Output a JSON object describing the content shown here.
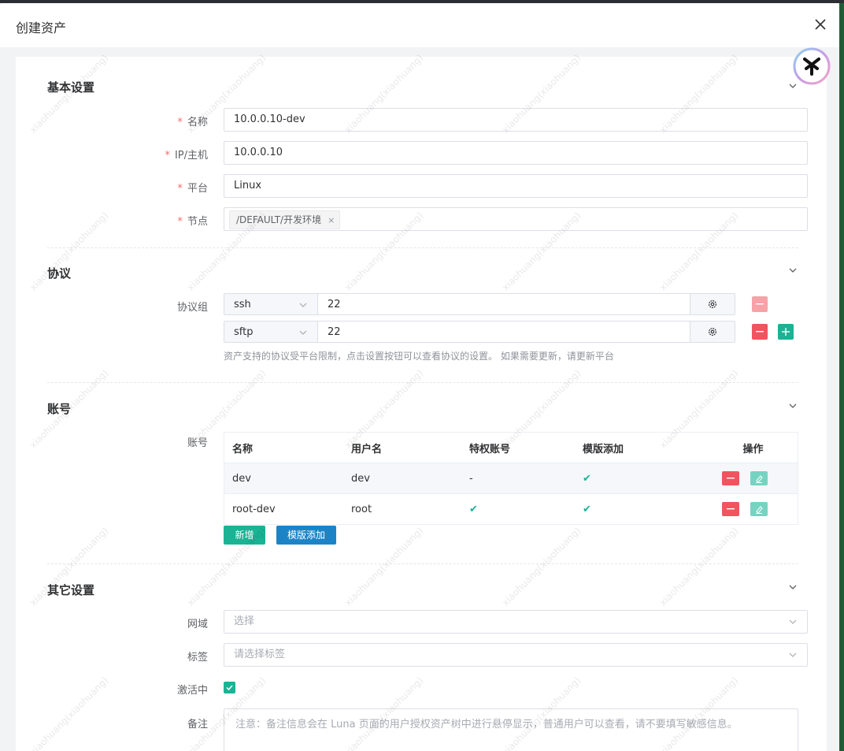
{
  "dialog": {
    "title": "创建资产"
  },
  "watermark": "xiaohuang(xiaohuang)",
  "basic": {
    "title": "基本设置",
    "name_label": "名称",
    "name_value": "10.0.0.10-dev",
    "ip_label": "IP/主机",
    "ip_value": "10.0.0.10",
    "platform_label": "平台",
    "platform_value": "Linux",
    "node_label": "节点",
    "node_tag": "/DEFAULT/开发环境",
    "node_tag_close": "×"
  },
  "protocol": {
    "title": "协议",
    "group_label": "协议组",
    "rows": [
      {
        "name": "ssh",
        "port": "22"
      },
      {
        "name": "sftp",
        "port": "22"
      }
    ],
    "hint": "资产支持的协议受平台限制，点击设置按钮可以查看协议的设置。 如果需要更新，请更新平台"
  },
  "accounts": {
    "title": "账号",
    "label": "账号",
    "columns": [
      "名称",
      "用户名",
      "特权账号",
      "模版添加",
      "操作"
    ],
    "rows": [
      {
        "name": "dev",
        "username": "dev",
        "privileged": "-"
      },
      {
        "name": "root-dev",
        "username": "root",
        "privileged": "✔"
      }
    ],
    "check": "✔",
    "add_button": "新增",
    "template_button": "模版添加"
  },
  "other": {
    "title": "其它设置",
    "domain_label": "网域",
    "domain_placeholder": "选择",
    "labels_label": "标签",
    "labels_placeholder": "请选择标签",
    "active_label": "激活中",
    "comment_label": "备注",
    "comment_placeholder": "注意：备注信息会在 Luna 页面的用户授权资产树中进行悬停显示，普通用户可以查看，请不要填写敏感信息。"
  },
  "colors": {
    "accent": "#1ab394",
    "danger": "#f0545e",
    "primary_blue": "#1c84c6"
  }
}
